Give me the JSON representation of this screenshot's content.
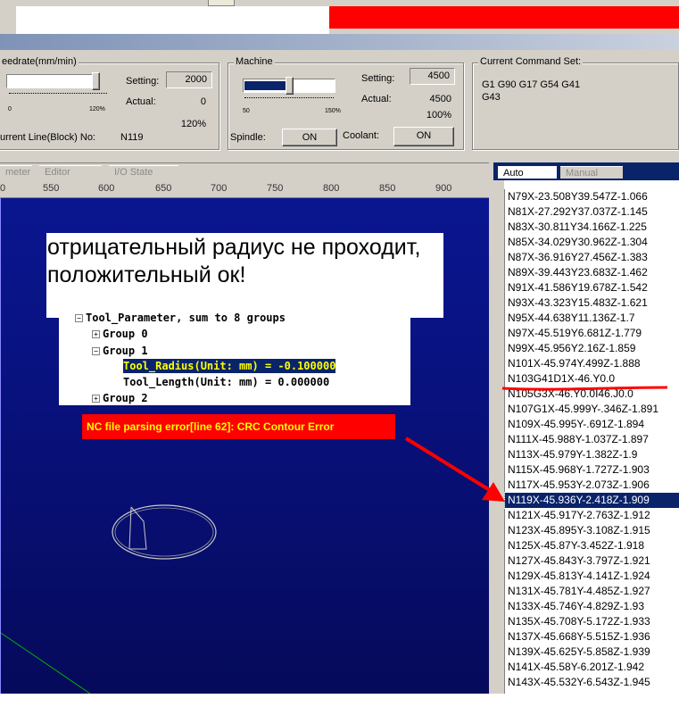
{
  "feedrate": {
    "title": "eedrate(mm/min)",
    "setting_label": "Setting:",
    "setting_value": "2000",
    "actual_label": "Actual:",
    "actual_value": "0",
    "percent": "120%",
    "tick_min": "0",
    "tick_max": "120%",
    "current_line_label": "urrent Line(Block) No:",
    "current_line_value": "N119",
    "slider_fraction": 1.0
  },
  "machine": {
    "title": "Machine",
    "setting_label": "Setting:",
    "setting_value": "4500",
    "actual_label": "Actual:",
    "actual_value": "4500",
    "percent": "100%",
    "tick_min": "50",
    "tick_max": "150%",
    "spindle_label": "Spindle:",
    "spindle_value": "ON",
    "coolant_label": "Coolant:",
    "coolant_value": "ON",
    "slider_fraction": 0.5
  },
  "command_set": {
    "title": "Current Command Set:",
    "text": "G1 G90 G17 G54 G41 G43"
  },
  "tabs": [
    "meter",
    "Editor",
    "I/O State"
  ],
  "right_tabs": [
    "Auto",
    "Manual"
  ],
  "ruler": [
    "0",
    "550",
    "600",
    "650",
    "700",
    "750",
    "800",
    "850",
    "900"
  ],
  "note": "отрицательный радиус не проходит, положительный ок!",
  "tree": {
    "root": "Tool_Parameter, sum to 8 groups",
    "group0": "Group 0",
    "group1": "Group 1",
    "radius": "Tool_Radius(Unit: mm) = -0.100000",
    "length": "Tool_Length(Unit: mm) = 0.000000",
    "group2": "Group 2"
  },
  "error": "NC file parsing error[line 62]: CRC Contour Error",
  "nc_lines": [
    "N79X-23.508Y39.547Z-1.066",
    "N81X-27.292Y37.037Z-1.145",
    "N83X-30.811Y34.166Z-1.225",
    "N85X-34.029Y30.962Z-1.304",
    "N87X-36.916Y27.456Z-1.383",
    "N89X-39.443Y23.683Z-1.462",
    "N91X-41.586Y19.678Z-1.542",
    "N93X-43.323Y15.483Z-1.621",
    "N95X-44.638Y11.136Z-1.7",
    "N97X-45.519Y6.681Z-1.779",
    "N99X-45.956Y2.16Z-1.859",
    "N101X-45.974Y.499Z-1.888",
    "N103G41D1X-46.Y0.0",
    "N105G3X-46.Y0.0I46.J0.0",
    "N107G1X-45.999Y-.346Z-1.891",
    "N109X-45.995Y-.691Z-1.894",
    "N111X-45.988Y-1.037Z-1.897",
    "N113X-45.979Y-1.382Z-1.9",
    "N115X-45.968Y-1.727Z-1.903",
    "N117X-45.953Y-2.073Z-1.906",
    "N119X-45.936Y-2.418Z-1.909",
    "N121X-45.917Y-2.763Z-1.912",
    "N123X-45.895Y-3.108Z-1.915",
    "N125X-45.87Y-3.452Z-1.918",
    "N127X-45.843Y-3.797Z-1.921",
    "N129X-45.813Y-4.141Z-1.924",
    "N131X-45.781Y-4.485Z-1.927",
    "N133X-45.746Y-4.829Z-1.93",
    "N135X-45.708Y-5.172Z-1.933",
    "N137X-45.668Y-5.515Z-1.936",
    "N139X-45.625Y-5.858Z-1.939",
    "N141X-45.58Y-6.201Z-1.942",
    "N143X-45.532Y-6.543Z-1.945"
  ],
  "selected_line_index": 20,
  "annotated_line_index": 12,
  "colors": {
    "annotation_red": "#ff0000",
    "canvas_blue": "#0a1690",
    "selection": "#0a246a"
  }
}
